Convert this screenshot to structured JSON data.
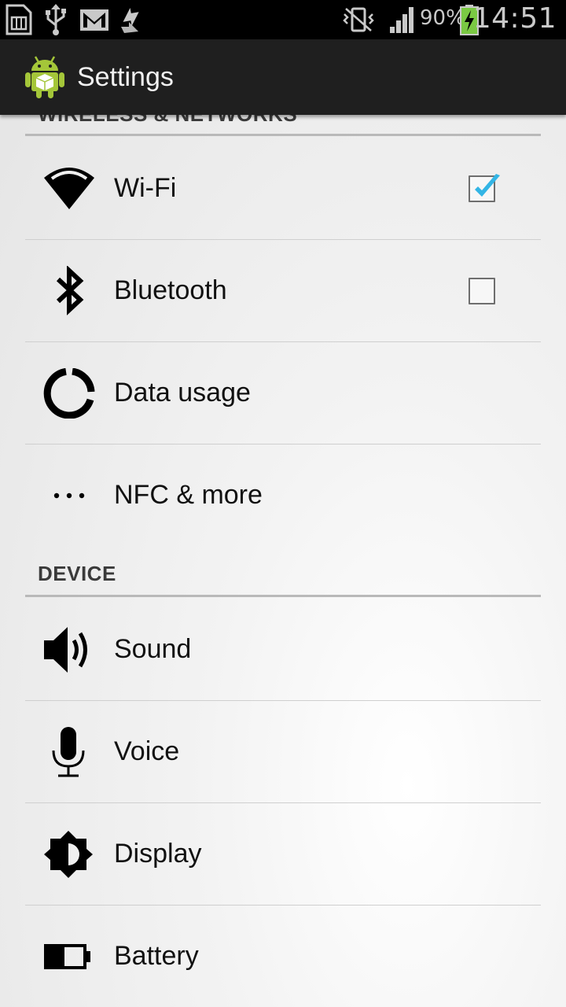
{
  "status_bar": {
    "battery_percent": "90%",
    "time": "14:51",
    "icons": [
      "sim-card-icon",
      "usb-icon",
      "gmail-icon",
      "sync-icon",
      "vibrate-icon",
      "signal-icon",
      "battery-charging-icon"
    ]
  },
  "action_bar": {
    "title": "Settings",
    "app_icon": "android-settings-icon"
  },
  "sections": {
    "wireless": {
      "header": "WIRELESS & NETWORKS",
      "items": [
        {
          "label": "Wi-Fi",
          "icon": "wifi-icon",
          "checkbox": true,
          "checked": true
        },
        {
          "label": "Bluetooth",
          "icon": "bluetooth-icon",
          "checkbox": true,
          "checked": false
        },
        {
          "label": "Data usage",
          "icon": "data-usage-icon"
        },
        {
          "label": "NFC & more",
          "icon": "more-icon"
        }
      ]
    },
    "device": {
      "header": "DEVICE",
      "items": [
        {
          "label": "Sound",
          "icon": "sound-icon"
        },
        {
          "label": "Voice",
          "icon": "microphone-icon"
        },
        {
          "label": "Display",
          "icon": "display-brightness-icon"
        },
        {
          "label": "Battery",
          "icon": "battery-icon"
        }
      ]
    }
  },
  "colors": {
    "status_bar_bg": "#000000",
    "action_bar_bg": "#1f1f1f",
    "checkbox_check": "#33b5e5",
    "battery_charging": "#7ac943"
  }
}
